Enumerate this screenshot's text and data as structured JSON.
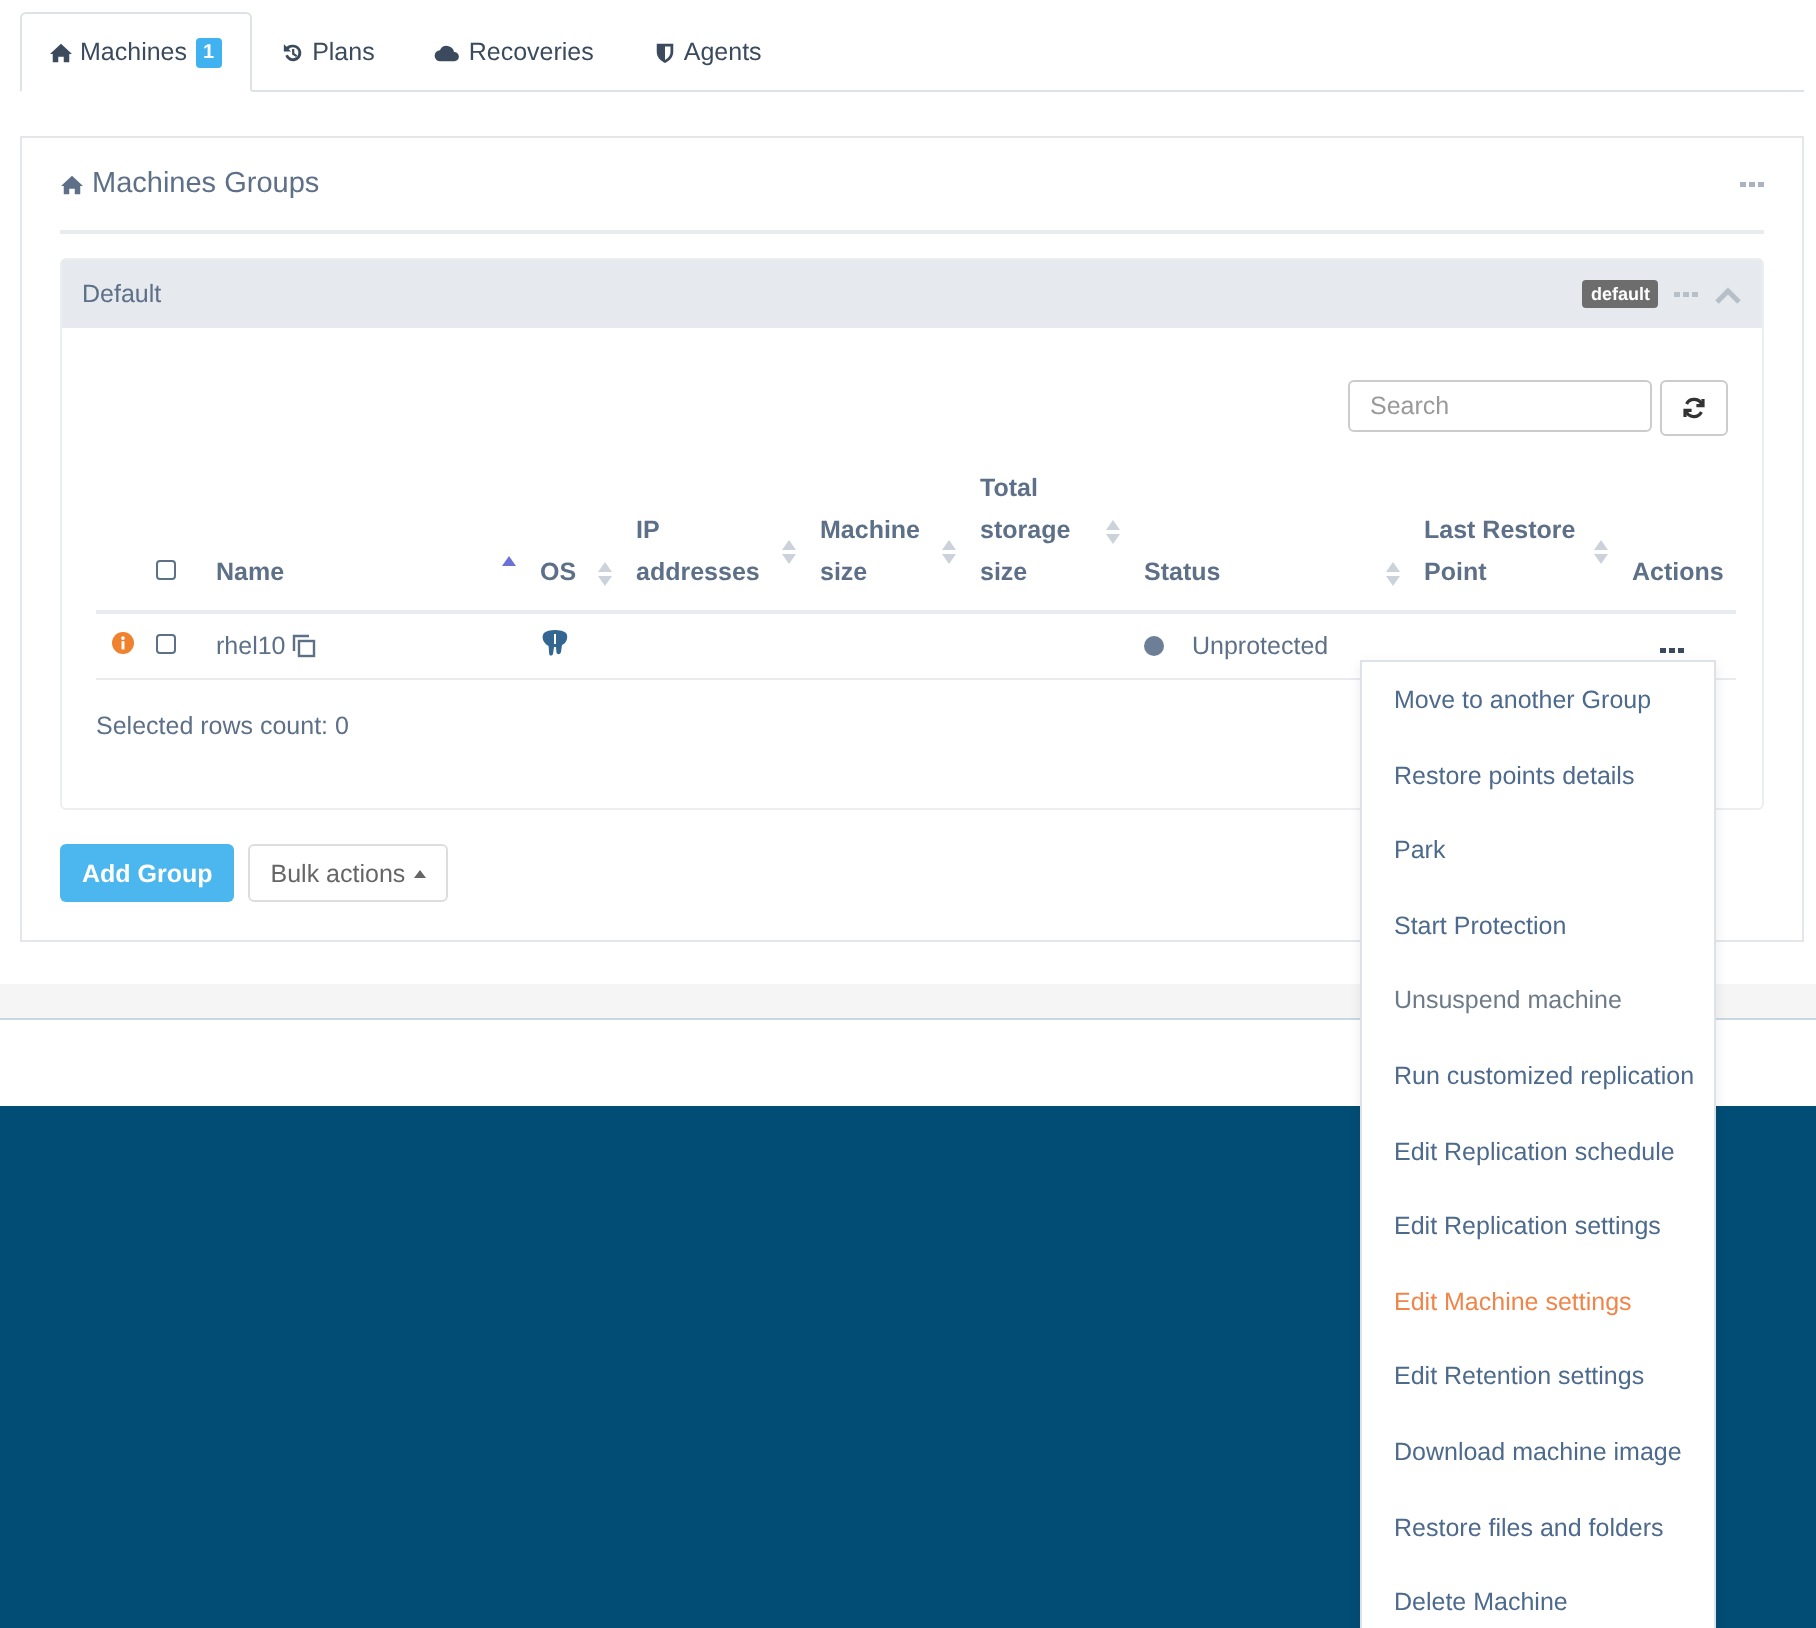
{
  "tabs": [
    {
      "label": "Machines",
      "badge": "1",
      "selected": true
    },
    {
      "label": "Plans",
      "selected": false
    },
    {
      "label": "Recoveries",
      "selected": false
    },
    {
      "label": "Agents",
      "selected": false
    }
  ],
  "panel": {
    "title": "Machines Groups"
  },
  "group": {
    "name": "Default",
    "tag": "default",
    "expanded": true,
    "search": {
      "placeholder": "Search"
    },
    "columns": [
      {
        "kind": "checkbox",
        "checked": false
      },
      {
        "kind": "sortable",
        "label": "Name",
        "sorted": true
      },
      {
        "kind": "sortable",
        "label": "OS",
        "sorted": false
      },
      {
        "kind": "sortable",
        "label": "IP addresses",
        "sorted": false
      },
      {
        "kind": "sortable",
        "label": "Machine size",
        "sorted": false
      },
      {
        "kind": "sortable",
        "label": "Total storage size",
        "sorted": false
      },
      {
        "kind": "sortable",
        "label": "Status",
        "sorted": false
      },
      {
        "kind": "sortable",
        "label": "Last Restore Point",
        "sorted": false
      },
      {
        "kind": "plain",
        "label": "Actions"
      }
    ],
    "rows": [
      {
        "warning": true,
        "checked": false,
        "name": "rhel10",
        "status": "Unprotected",
        "color": "#6c7f96"
      }
    ],
    "selected_count": "Selected rows count: 0"
  },
  "buttons": {
    "add": "Add Group",
    "bulk": "Bulk actions"
  },
  "menu": [
    {
      "label": "Move to another Group",
      "disabled": false,
      "highlighted": false
    },
    {
      "label": "Restore points details",
      "disabled": false,
      "highlighted": false
    },
    {
      "label": "Park",
      "disabled": false,
      "highlighted": false
    },
    {
      "label": "Start Protection",
      "disabled": false,
      "highlighted": false
    },
    {
      "label": "Unsuspend machine",
      "disabled": true,
      "highlighted": false
    },
    {
      "label": "Run customized replication",
      "disabled": false,
      "highlighted": false
    },
    {
      "label": "Edit Replication schedule",
      "disabled": false,
      "highlighted": false
    },
    {
      "label": "Edit Replication settings",
      "disabled": false,
      "highlighted": false
    },
    {
      "label": "Edit Machine settings",
      "disabled": false,
      "highlighted": true
    },
    {
      "label": "Edit Retention settings",
      "disabled": false,
      "highlighted": false
    },
    {
      "label": "Download machine image",
      "disabled": false,
      "highlighted": false
    },
    {
      "label": "Restore files and folders",
      "disabled": false,
      "highlighted": false
    },
    {
      "label": "Delete Machine",
      "disabled": false,
      "highlighted": false
    }
  ]
}
